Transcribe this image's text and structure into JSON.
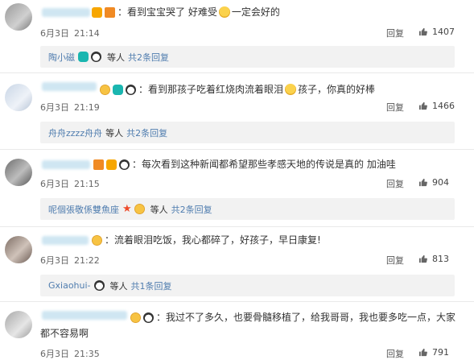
{
  "comments": [
    {
      "text": "：看到宝宝哭了 好难受",
      "text_tail": "一定会好的",
      "date": "6月3日",
      "time": "21:14",
      "reply_label": "回复",
      "likes": "1407",
      "sub": {
        "user": "陶小磁",
        "mid": "等人",
        "count": "共2条回复"
      }
    },
    {
      "text": "：看到那孩子吃着红烧肉流着眼泪",
      "text_tail": "孩子，你真的好棒",
      "date": "6月3日",
      "time": "21:19",
      "reply_label": "回复",
      "likes": "1466",
      "sub": {
        "user": "舟舟zzzz舟舟",
        "mid": "等人",
        "count": "共2条回复"
      }
    },
    {
      "text": "：每次看到这种新闻都希望那些孝感天地的传说是真的 加油哇",
      "date": "6月3日",
      "time": "21:15",
      "reply_label": "回复",
      "likes": "904",
      "sub": {
        "user": "呢個張敬係雙魚座",
        "mid": "等人",
        "count": "共2条回复"
      }
    },
    {
      "text": "：流着眼泪吃饭，我心都碎了，好孩子，早日康复!",
      "date": "6月3日",
      "time": "21:22",
      "reply_label": "回复",
      "likes": "813",
      "sub": {
        "user": "Gxiaohui-",
        "mid": "等人",
        "count": "共1条回复"
      }
    },
    {
      "text": "：我过不了多久，也要骨髓移植了，给我哥哥，我也要多吃一点，大家",
      "text_line2": "都不容易啊",
      "date": "6月3日",
      "time": "21:35",
      "reply_label": "回复",
      "likes": "791"
    }
  ],
  "icons": {
    "like": "thumbs-up-icon",
    "badges": [
      "vip-badge-icon",
      "camera-badge-icon",
      "panda-icon",
      "smile-emoji-icon",
      "star-icon"
    ]
  },
  "colors": {
    "link": "#507daf",
    "sub_bg": "#f2f2f2",
    "text": "#333333"
  }
}
